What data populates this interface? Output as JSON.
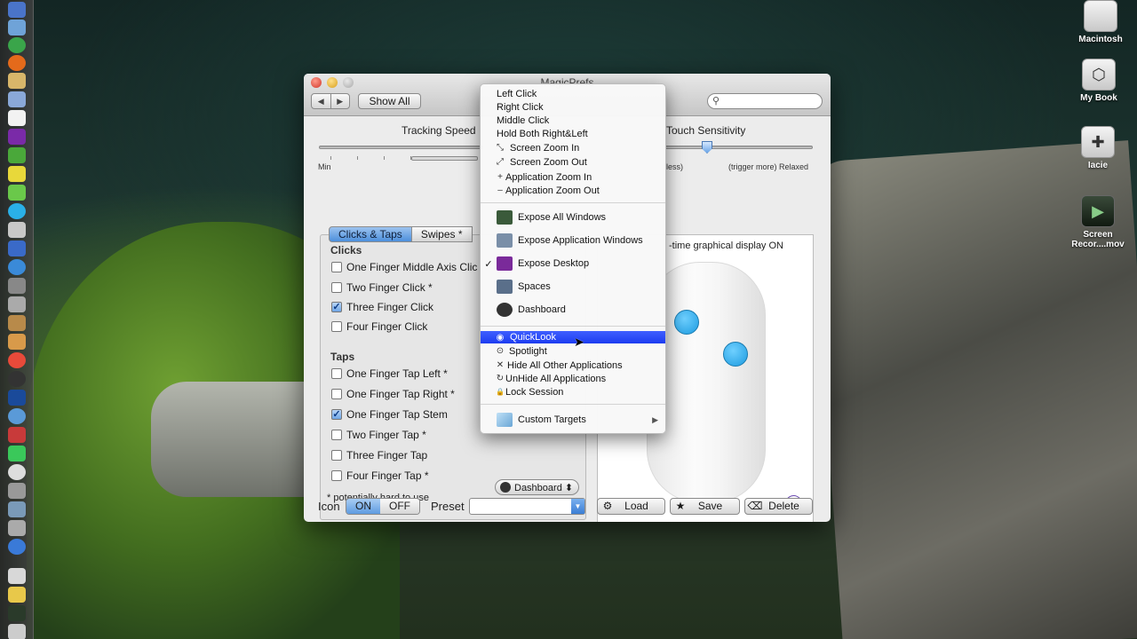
{
  "window": {
    "title": "MagicPrefs",
    "nav_back": "◀",
    "nav_forward": "▶",
    "show_all": "Show All",
    "search_placeholder": ""
  },
  "tracking": {
    "label": "Tracking Speed",
    "min_label": "Min"
  },
  "sensitivity": {
    "label": "Touch Sensitivity",
    "less_label": "less)",
    "more_label": "(trigger more) Relaxed"
  },
  "tabs": [
    {
      "label": "Clicks & Taps",
      "active": true
    },
    {
      "label": "Swipes *",
      "active": false
    }
  ],
  "clicks": {
    "heading": "Clicks",
    "items": [
      {
        "label": "One Finger Middle Axis Clic",
        "checked": false
      },
      {
        "label": "Two Finger Click *",
        "checked": false
      },
      {
        "label": "Three Finger Click",
        "checked": true
      },
      {
        "label": "Four Finger Click",
        "checked": false
      }
    ]
  },
  "taps": {
    "heading": "Taps",
    "items": [
      {
        "label": "One Finger Tap Left *",
        "checked": false
      },
      {
        "label": "One Finger Tap Right *",
        "checked": false
      },
      {
        "label": "One Finger Tap  Stem",
        "checked": true
      },
      {
        "label": "Two Finger Tap *",
        "checked": false
      },
      {
        "label": "Three Finger Tap",
        "checked": false
      },
      {
        "label": "Four Finger Tap *",
        "checked": false
      }
    ],
    "four_finger_popup": "Dashboard ⬍"
  },
  "footnote": "* potentially hard to use",
  "display_toggle": "-time graphical display ON",
  "help": "?",
  "bottom": {
    "icon_label": "Icon",
    "on": "ON",
    "off": "OFF",
    "preset_label": "Preset",
    "preset_value": "",
    "load": "Load",
    "save": "Save",
    "delete": "Delete"
  },
  "menu": {
    "items_top": [
      {
        "label": "Left Click",
        "glyph": ""
      },
      {
        "label": "Right Click",
        "glyph": ""
      },
      {
        "label": "Middle Click",
        "glyph": ""
      },
      {
        "label": "Hold Both Right&Left",
        "glyph": ""
      },
      {
        "label": "Screen Zoom In",
        "glyph": "⤡"
      },
      {
        "label": "Screen Zoom Out",
        "glyph": "⤢"
      },
      {
        "label": "Application Zoom In",
        "glyph": "+"
      },
      {
        "label": "Application Zoom Out",
        "glyph": "–"
      }
    ],
    "items_mid": [
      {
        "label": "Expose All Windows",
        "checked": false,
        "color": "#3a5a3a"
      },
      {
        "label": "Expose Application Windows",
        "checked": false,
        "color": "#7a8fa8"
      },
      {
        "label": "Expose Desktop",
        "checked": true,
        "color": "#7a2a9a"
      },
      {
        "label": "Spaces",
        "checked": false,
        "color": "#5a6f8a"
      },
      {
        "label": "Dashboard",
        "checked": false,
        "color": "#333333"
      }
    ],
    "items_low": [
      {
        "label": "QuickLook",
        "glyph": "◉",
        "selected": true
      },
      {
        "label": "Spotlight",
        "glyph": "⊙",
        "selected": false
      },
      {
        "label": "Hide All Other Applications",
        "glyph": "✕",
        "selected": false
      },
      {
        "label": "UnHide All Applications",
        "glyph": "↻",
        "selected": false
      },
      {
        "label": "Lock Session",
        "glyph": "🔒",
        "selected": false
      }
    ],
    "custom_targets": "Custom Targets"
  },
  "desktop_icons": [
    {
      "label": "Macintosh",
      "icon": "apple-drive-icon"
    },
    {
      "label": "My Book",
      "icon": "external-drive-icon"
    },
    {
      "label": "Iacie",
      "icon": "usb-drive-icon"
    },
    {
      "label": "Screen Recor....mov",
      "icon": "movie-file-icon"
    }
  ]
}
